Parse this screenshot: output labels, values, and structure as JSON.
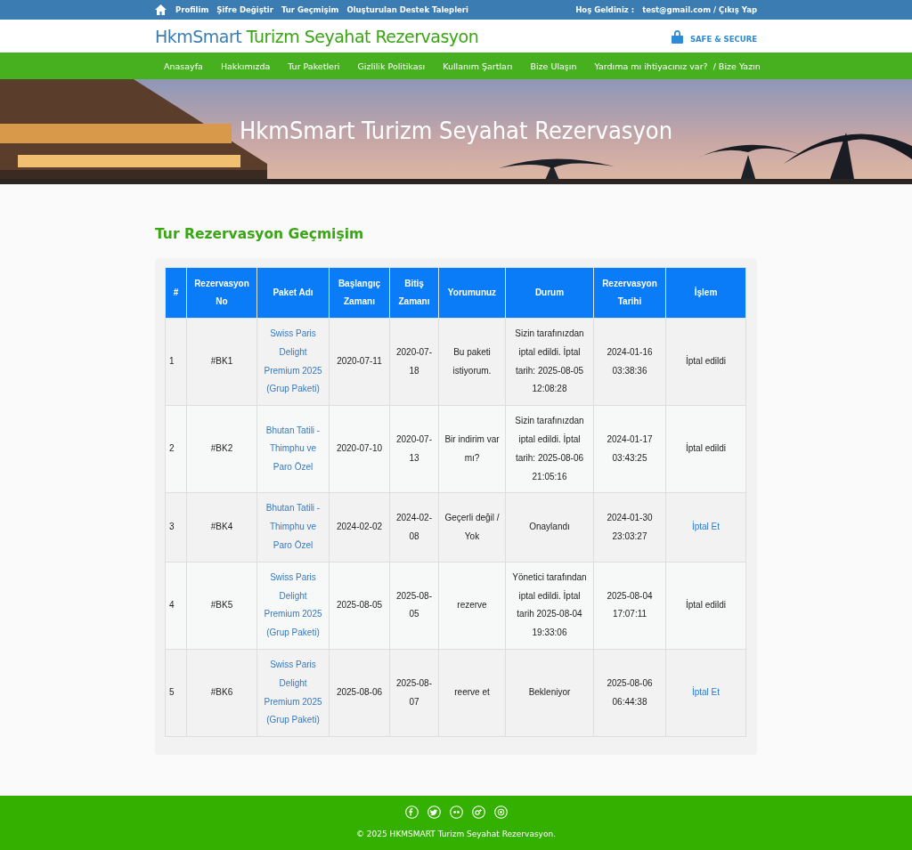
{
  "top_bar": {
    "links": [
      "Profilim",
      "Şifre Değiştir",
      "Tur Geçmişim",
      "Oluşturulan Destek Talepleri"
    ],
    "welcome": "Hoş Geldiniz :",
    "account": "test@gmail.com / Çıkış Yap"
  },
  "header": {
    "logo_first": "HkmSmart",
    "logo_rest": "Turizm Seyahat Rezervasyon",
    "secure": "SAFE & SECURE"
  },
  "nav": [
    "Anasayfa",
    "Hakkımızda",
    "Tur Paketleri",
    "Gizlilik Politikası",
    "Kullanım Şartları",
    "Bize Ulaşın",
    "Yardıma mı ihtiyacınız var?  / Bize Yazın"
  ],
  "hero": {
    "title": "HkmSmart Turizm Seyahat Rezervasyon"
  },
  "section_title": "Tur Rezervasyon Geçmişim",
  "table": {
    "columns": [
      "#",
      "Rezervasyon No",
      "Paket Adı",
      "Başlangıç Zamanı",
      "Bitiş Zamanı",
      "Yorumunuz",
      "Durum",
      "Rezervasyon Tarihi",
      "İşlem"
    ],
    "rows": [
      {
        "cells": [
          "1",
          "#BK1",
          "Swiss Paris Delight Premium 2025 (Grup Paketi)",
          "2020-07-11",
          "2020-07-18",
          "Bu paketi istiyorum.",
          "Sizin tarafınızdan iptal edildi. İptal tarih: 2025-08-05 12:08:28",
          "2024-01-16 03:38:36"
        ],
        "action": {
          "kind": "text",
          "label": "İptal edildi"
        }
      },
      {
        "cells": [
          "2",
          "#BK2",
          "Bhutan Tatili - Thimphu ve Paro Özel",
          "2020-07-10",
          "2020-07-13",
          "Bir indirim var mı?",
          "Sizin tarafınızdan iptal edildi. İptal tarih: 2025-08-06 21:05:16",
          "2024-01-17 03:43:25"
        ],
        "action": {
          "kind": "text",
          "label": "İptal edildi"
        }
      },
      {
        "cells": [
          "3",
          "#BK4",
          "Bhutan Tatili - Thimphu ve Paro Özel",
          "2024-02-02",
          "2024-02-08",
          "Geçerli değil / Yok",
          "Onaylandı",
          "2024-01-30 23:03:27"
        ],
        "action": {
          "kind": "link",
          "label": "İptal Et"
        }
      },
      {
        "cells": [
          "4",
          "#BK5",
          "Swiss Paris Delight Premium 2025 (Grup Paketi)",
          "2025-08-05",
          "2025-08-05",
          "rezerve",
          "Yönetici tarafından iptal edildi. İptal tarih 2025-08-04 19:33:06",
          "2025-08-04 17:07:11"
        ],
        "action": {
          "kind": "text",
          "label": "İptal edildi"
        }
      },
      {
        "cells": [
          "5",
          "#BK6",
          "Swiss Paris Delight Premium 2025 (Grup Paketi)",
          "2025-08-06",
          "2025-08-07",
          "reerve et",
          "Bekleniyor",
          "2025-08-06 06:44:38"
        ],
        "action": {
          "kind": "link",
          "label": "İptal Et"
        }
      }
    ]
  },
  "footer": {
    "copyright": "© 2025 HKMSMART Turizm Seyahat Rezervasyon."
  }
}
